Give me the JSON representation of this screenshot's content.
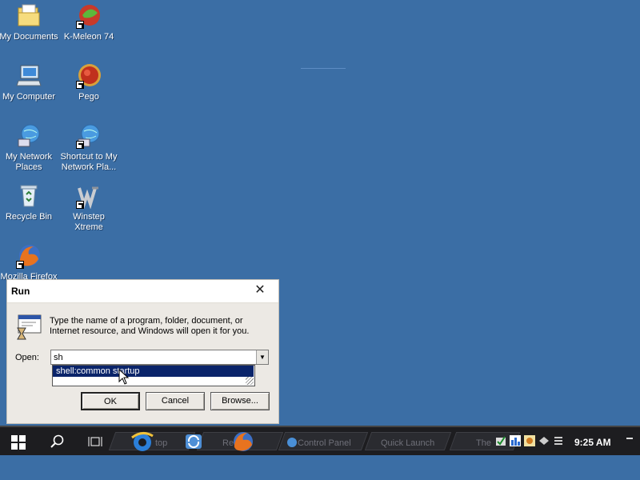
{
  "desktop": {
    "icons": [
      {
        "label": "My Documents"
      },
      {
        "label": "K-Meleon 74"
      },
      {
        "label": "My Computer"
      },
      {
        "label": "Pego"
      },
      {
        "label": "My Network Places"
      },
      {
        "label": "Shortcut to My Network Pla..."
      },
      {
        "label": "Recycle Bin"
      },
      {
        "label": "Winstep Xtreme"
      },
      {
        "label": "Mozilla Firefox"
      }
    ]
  },
  "run_dialog": {
    "title": "Run",
    "description": "Type the name of a program, folder, document, or Internet resource, and Windows will open it for you.",
    "open_label": "Open:",
    "open_value": "sh",
    "autocomplete_item": "shell:common startup",
    "ok_label": "OK",
    "cancel_label": "Cancel",
    "browse_label": "Browse..."
  },
  "taskbar": {
    "tabs": [
      {
        "label": "top"
      },
      {
        "label": "Re"
      },
      {
        "label": "Control Panel"
      },
      {
        "label": "Quick Launch"
      },
      {
        "label": "The"
      }
    ],
    "clock": "9:25 AM"
  },
  "colors": {
    "desktop": "#3b6ea5",
    "selection": "#0a246a",
    "taskbar": "#1d1d20"
  }
}
